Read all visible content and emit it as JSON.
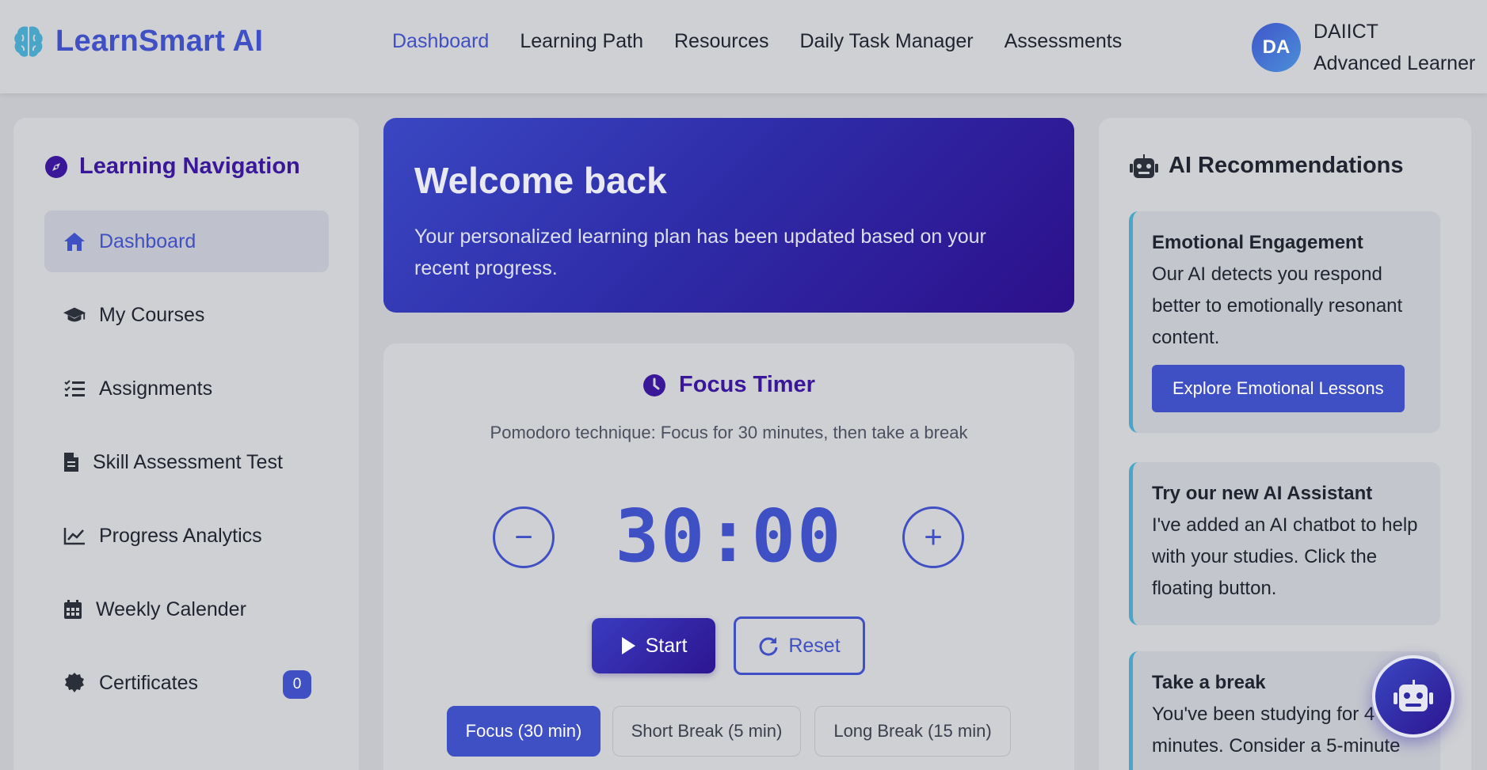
{
  "brand": {
    "name": "LearnSmart AI",
    "icon": "brain-icon"
  },
  "nav": {
    "items": [
      {
        "label": "Dashboard",
        "active": true
      },
      {
        "label": "Learning Path"
      },
      {
        "label": "Resources"
      },
      {
        "label": "Daily Task Manager"
      },
      {
        "label": "Assessments"
      }
    ]
  },
  "user": {
    "initials": "DA",
    "name": "DAIICT",
    "level": "Advanced Learner"
  },
  "sidebar": {
    "title": "Learning Navigation",
    "items": [
      {
        "label": "Dashboard",
        "icon": "home-icon",
        "active": true
      },
      {
        "label": "My Courses",
        "icon": "graduation-cap-icon"
      },
      {
        "label": "Assignments",
        "icon": "tasks-icon"
      },
      {
        "label": "Skill Assessment Test",
        "icon": "file-icon"
      },
      {
        "label": "Progress Analytics",
        "icon": "chart-line-icon"
      },
      {
        "label": "Weekly Calender",
        "icon": "calendar-icon"
      },
      {
        "label": "Certificates",
        "icon": "certificate-icon",
        "badge": "0"
      }
    ]
  },
  "welcome": {
    "title": "Welcome back",
    "message": "Your personalized learning plan has been updated based on your recent progress."
  },
  "timer": {
    "title": "Focus Timer",
    "subtitle": "Pomodoro technique: Focus for 30 minutes, then take a break",
    "time": "30:00",
    "decrease": "−",
    "increase": "+",
    "start_label": "Start",
    "reset_label": "Reset",
    "modes": [
      {
        "label": "Focus (30 min)",
        "active": true
      },
      {
        "label": "Short Break (5 min)"
      },
      {
        "label": "Long Break (15 min)"
      }
    ]
  },
  "recommendations": {
    "title": "AI Recommendations",
    "items": [
      {
        "title": "Emotional Engagement",
        "text": "Our AI detects you respond better to emotionally resonant content.",
        "button": "Explore Emotional Lessons"
      },
      {
        "title": "Try our new AI Assistant",
        "text": "I've added an AI chatbot to help with your studies. Click the floating button."
      },
      {
        "title": "Take a break",
        "text": "You've been studying for 4 minutes. Consider a 5-minute"
      }
    ]
  },
  "colors": {
    "accent": "#3f4fc4",
    "heading": "#3a1799",
    "rec_border": "#4aa6c9"
  }
}
